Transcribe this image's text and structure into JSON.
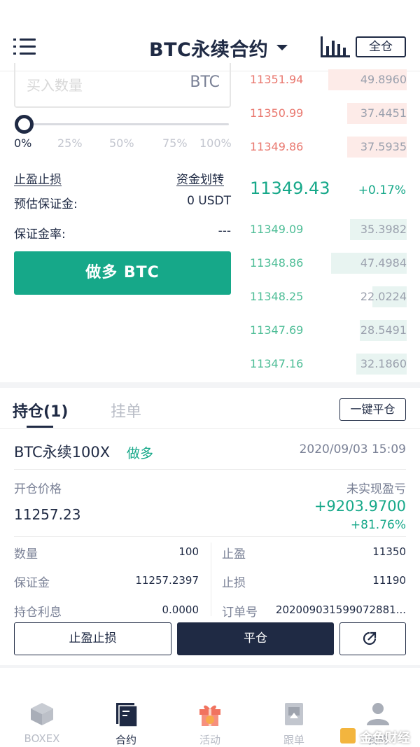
{
  "header": {
    "title": "BTC永续合约",
    "margin_mode": "全仓"
  },
  "order_form": {
    "qty_placeholder": "买入数量",
    "qty_unit": "BTC",
    "slider_value_pct": 0,
    "slider_labels": [
      "0%",
      "25%",
      "50%",
      "75%",
      "100%"
    ],
    "tp_sl_link": "止盈止损",
    "transfer_link": "资金划转",
    "est_margin_label": "预估保证金:",
    "est_margin_value": "0 USDT",
    "margin_rate_label": "保证金率:",
    "margin_rate_value": "---",
    "long_button": "做多 BTC"
  },
  "order_book": {
    "asks": [
      {
        "price": "11351.94",
        "amount": "49.8960",
        "depth": 0.5
      },
      {
        "price": "11350.99",
        "amount": "37.4451",
        "depth": 0.38
      },
      {
        "price": "11349.86",
        "amount": "37.5935",
        "depth": 0.38
      }
    ],
    "last_price": "11349.43",
    "change": "+0.17%",
    "bids": [
      {
        "price": "11349.09",
        "amount": "35.3982",
        "depth": 0.36
      },
      {
        "price": "11348.86",
        "amount": "47.4984",
        "depth": 0.48
      },
      {
        "price": "11348.25",
        "amount": "22.0224",
        "depth": 0.22
      },
      {
        "price": "11347.69",
        "amount": "28.5491",
        "depth": 0.3
      },
      {
        "price": "11347.16",
        "amount": "32.1860",
        "depth": 0.32
      }
    ]
  },
  "tabs": {
    "positions": "持仓(1)",
    "orders": "挂单",
    "close_all": "一键平仓"
  },
  "position": {
    "symbol": "BTC永续100X",
    "side": "做多",
    "time": "2020/09/03 15:09",
    "open_price_label": "开仓价格",
    "open_price": "11257.23",
    "pnl_label": "未实现盈亏",
    "pnl": "+9203.9700",
    "pnl_pct": "+81.76%",
    "qty_label": "数量",
    "qty": "100",
    "margin_label": "保证金",
    "margin": "11257.2397",
    "interest_label": "持仓利息",
    "interest": "0.0000",
    "tp_label": "止盈",
    "tp": "11350",
    "sl_label": "止损",
    "sl": "11190",
    "order_no_label": "订单号",
    "order_no": "202009031599072881...",
    "tp_sl_button": "止盈止损",
    "close_button": "平仓"
  },
  "nav": [
    {
      "label": "BOXEX",
      "icon": "cube-icon"
    },
    {
      "label": "合约",
      "icon": "contract-icon"
    },
    {
      "label": "活动",
      "icon": "gift-icon"
    },
    {
      "label": "跟单",
      "icon": "follow-icon"
    },
    {
      "label": "我的",
      "icon": "user-icon"
    }
  ],
  "watermark": "金色财经",
  "colors": {
    "brand_dark": "#1f2a44",
    "green": "#16a889",
    "red": "#e9776e"
  }
}
